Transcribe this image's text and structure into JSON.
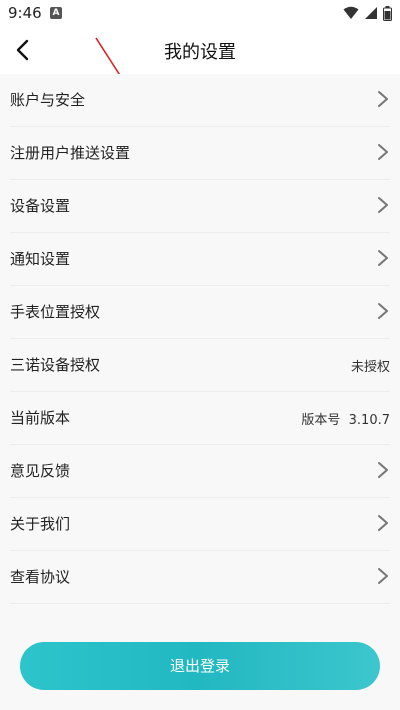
{
  "status_bar": {
    "time": "9:46",
    "notification_badge": "A"
  },
  "header": {
    "title": "我的设置",
    "back_icon": "chevron-left-icon"
  },
  "settings": {
    "items": [
      {
        "label": "账户与安全",
        "value": null,
        "chevron": true
      },
      {
        "label": "注册用户推送设置",
        "value": null,
        "chevron": true
      },
      {
        "label": "设备设置",
        "value": null,
        "chevron": true
      },
      {
        "label": "通知设置",
        "value": null,
        "chevron": true
      },
      {
        "label": "手表位置授权",
        "value": null,
        "chevron": true
      },
      {
        "label": "三诺设备授权",
        "value": "未授权",
        "chevron": false
      },
      {
        "label": "当前版本",
        "value": "版本号  3.10.7",
        "chevron": false
      },
      {
        "label": "意见反馈",
        "value": null,
        "chevron": true
      },
      {
        "label": "关于我们",
        "value": null,
        "chevron": true
      },
      {
        "label": "查看协议",
        "value": null,
        "chevron": true
      }
    ]
  },
  "footer": {
    "logout_label": "退出登录"
  },
  "colors": {
    "accent": "#29bfc8",
    "annotation": "#e02020"
  }
}
